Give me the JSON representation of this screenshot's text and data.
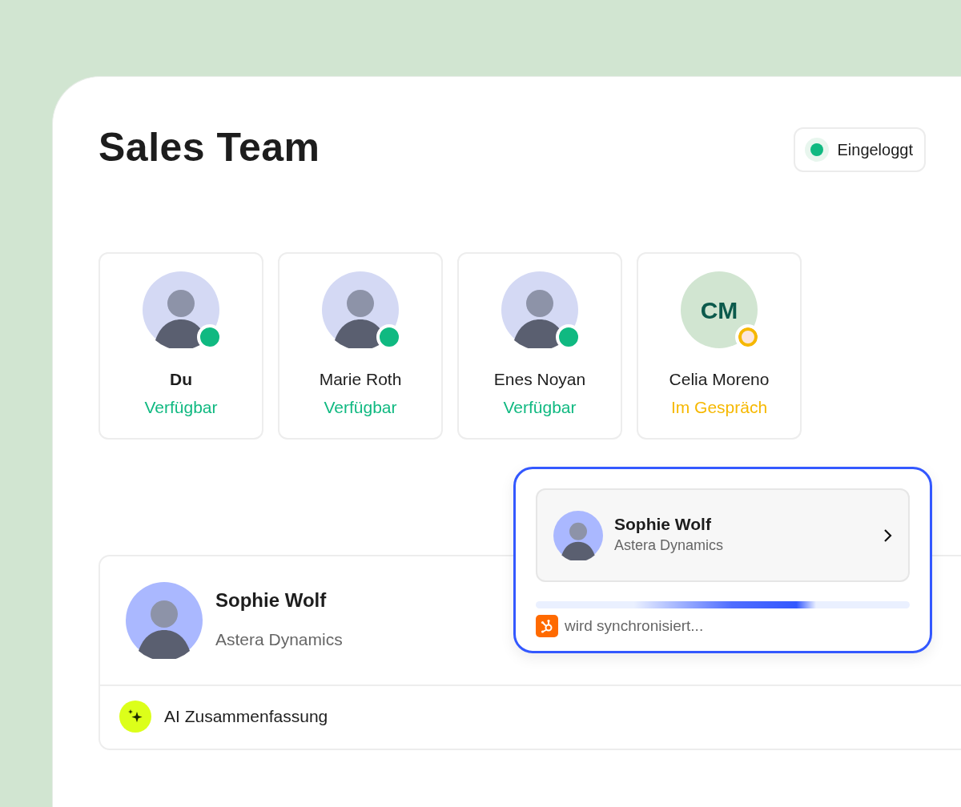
{
  "header": {
    "title": "Sales Team",
    "status": {
      "label": "Eingeloggt",
      "online": true
    }
  },
  "members": [
    {
      "name": "Du",
      "status": "Verfügbar",
      "color": "#10b981",
      "busy": false,
      "current_user": true,
      "avatar": {
        "kind": "photo"
      }
    },
    {
      "name": "Marie Roth",
      "status": "Verfügbar",
      "color": "#10b981",
      "busy": false,
      "current_user": false,
      "avatar": {
        "kind": "photo"
      }
    },
    {
      "name": "Enes Noyan",
      "status": "Verfügbar",
      "color": "#10b981",
      "busy": false,
      "current_user": false,
      "avatar": {
        "kind": "photo"
      }
    },
    {
      "name": "Celia Moreno",
      "status": "Im Gespräch",
      "color": "#f6b800",
      "busy": true,
      "current_user": false,
      "avatar": {
        "kind": "initials",
        "initials": "CM"
      }
    }
  ],
  "contact": {
    "name": "Sophie Wolf",
    "company": "Astera Dynamics",
    "ai_summary": "AI Zusammenfassung"
  },
  "sync_popup": {
    "name": "Sophie Wolf",
    "company": "Astera Dynamics",
    "status": "wird synchronisiert...",
    "progress": {
      "level": 0.75
    }
  }
}
